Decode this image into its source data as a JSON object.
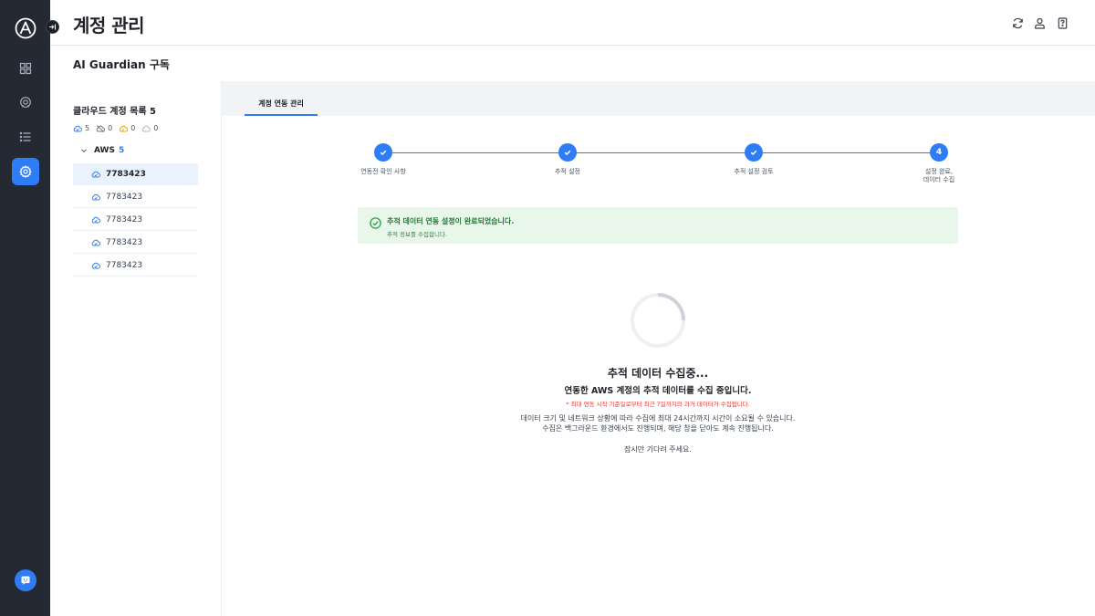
{
  "header": {
    "title": "계정 관리",
    "icons": [
      "refresh-icon",
      "user-icon",
      "help-icon"
    ]
  },
  "subheader": {
    "title": "AI Guardian 구독"
  },
  "rail": {
    "items": [
      "dashboard-icon",
      "brain-icon",
      "list-icon",
      "settings-icon"
    ],
    "active": "settings-icon",
    "accent": "#2f7df6"
  },
  "sidebar": {
    "title": "클라우드 계정 목록 5",
    "stats": [
      {
        "icon": "cloud-ok-icon",
        "value": "5",
        "color": "#2f7df6"
      },
      {
        "icon": "cloud-off-icon",
        "value": "0",
        "color": "#6b7280"
      },
      {
        "icon": "cloud-warn-icon",
        "value": "0",
        "color": "#e0a800"
      },
      {
        "icon": "cloud-idle-icon",
        "value": "0",
        "color": "#b0b5bd"
      }
    ],
    "provider": {
      "label": "AWS",
      "count": "5"
    },
    "accounts": [
      {
        "id": "7783423",
        "selected": true
      },
      {
        "id": "7783423",
        "selected": false
      },
      {
        "id": "7783423",
        "selected": false
      },
      {
        "id": "7783423",
        "selected": false
      },
      {
        "id": "7783423",
        "selected": false
      }
    ]
  },
  "main": {
    "tab": "계정 연동 관리",
    "steps": [
      {
        "label": "연동전 확인 사항",
        "status": "done"
      },
      {
        "label": "추적 설정",
        "status": "done"
      },
      {
        "label": "추적 설정 검토",
        "status": "done"
      },
      {
        "label_line1": "설정 완료,",
        "label_line2": "데이터 수집",
        "number": "4",
        "status": "current"
      }
    ],
    "banner": {
      "title": "추적 데이터 연동 설정이 완료되었습니다.",
      "sub": "추적 정보를 수집합니다.",
      "color": "#1e7a34"
    },
    "loading": {
      "title": "추적 데이터 수집중...",
      "subtitle": "연동한 AWS 계정의 추적 데이터를 수집 중입니다.",
      "note": "* 최대 연동 시작 기준일로부터 최근 7일까지의 과거 데이터가 수집됩니다.",
      "desc_line1": "데이터 크기 및 네트워크 상황에 따라 수집에 최대 24시간까지 시간이 소요될 수 있습니다.",
      "desc_line2": "수집은 백그라운드 환경에서도 진행되며, 해당 창을 닫아도 계속 진행됩니다.",
      "wait": "잠시만 기다려 주세요.",
      "progress": 0.25
    }
  }
}
